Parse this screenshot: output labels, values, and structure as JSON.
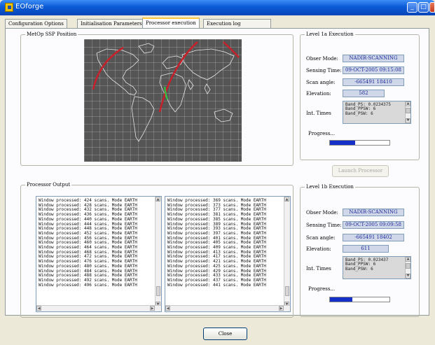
{
  "window": {
    "title": "EOforge"
  },
  "tabs": [
    "Configuration Options",
    "Initialisation Parameters",
    "Processor execution",
    "Execution log"
  ],
  "map_group": {
    "title": "MetOp SSP Position"
  },
  "level1a": {
    "title": "Level 1a Execution",
    "obser_mode_label": "Obser Mode:",
    "obser_mode": "NADIR-SCANNING",
    "sensing_time_label": "Sensing Time:",
    "sensing_time": "09-OCT-2005 09:15:08",
    "scan_angle_label": "Scan angle:",
    "scan_angle": "-665491 18410",
    "elevation_label": "Elevation:",
    "elevation": "582",
    "int_times_label": "Int. Times",
    "int_times_lines": "Band_PS: 0.0234375\nBand_PPSW: 6\nBand_PSW: 6",
    "progress_label": "Progress...",
    "progress": 0.42
  },
  "launch_button": "Launch Processor",
  "level1b": {
    "title": "Level 1b Execution",
    "obser_mode_label": "Obser Mode:",
    "obser_mode": "NADIR-SCANNING",
    "sensing_time_label": "Sensing Time:",
    "sensing_time": "09-OCT-2005 09:09:58",
    "scan_angle_label": "Scan angle:",
    "scan_angle": "-665491 18402",
    "elevation_label": "Elevation:",
    "elevation": "611",
    "int_times_label": "Int. Times",
    "int_times_lines": "Band_PS: 0.023437\nBand_PPSW: 6\nBand_PSW: 6",
    "progress_label": "Progress...",
    "progress": 0.38
  },
  "processor_output": {
    "title": "Processor Output",
    "left_lines": "Window processed: 424 scans. Mode EARTH\nWindow processed: 428 scans. Mode EARTH\nWindow processed: 432 scans. Mode EARTH\nWindow processed: 436 scans. Mode EARTH\nWindow processed: 440 scans. Mode EARTH\nWindow processed: 444 scans. Mode EARTH\nWindow processed: 448 scans. Mode EARTH\nWindow processed: 452 scans. Mode EARTH\nWindow processed: 456 scans. Mode EARTH\nWindow processed: 460 scans. Mode EARTH\nWindow processed: 464 scans. Mode EARTH\nWindow processed: 468 scans. Mode EARTH\nWindow processed: 472 scans. Mode EARTH\nWindow processed: 476 scans. Mode EARTH\nWindow processed: 480 scans. Mode EARTH\nWindow processed: 484 scans. Mode EARTH\nWindow processed: 488 scans. Mode EARTH\nWindow processed: 492 scans. Mode EARTH\nWindow processed: 496 scans. Mode EARTH",
    "right_lines": "Window processed: 369 scans. Mode EARTH\nWindow processed: 373 scans. Mode EARTH\nWindow processed: 377 scans. Mode EARTH\nWindow processed: 381 scans. Mode EARTH\nWindow processed: 385 scans. Mode EARTH\nWindow processed: 389 scans. Mode EARTH\nWindow processed: 393 scans. Mode EARTH\nWindow processed: 397 scans. Mode EARTH\nWindow processed: 401 scans. Mode EARTH\nWindow processed: 405 scans. Mode EARTH\nWindow processed: 409 scans. Mode EARTH\nWindow processed: 413 scans. Mode EARTH\nWindow processed: 417 scans. Mode EARTH\nWindow processed: 421 scans. Mode EARTH\nWindow processed: 425 scans. Mode EARTH\nWindow processed: 429 scans. Mode EARTH\nWindow processed: 433 scans. Mode EARTH\nWindow processed: 437 scans. Mode EARTH\nWindow processed: 441 scans. Mode EARTH"
  },
  "close_button": "Close",
  "colors": {
    "titlebar": "#0a5ad6",
    "progress_fill": "#1430c9",
    "value_text": "#1e2a9a",
    "orbit_track": "#c8202a",
    "map_bg": "#555555"
  },
  "icons": {
    "app": "eoforge-logo-icon",
    "minimize": "minimize-icon",
    "maximize": "maximize-icon",
    "close": "close-icon"
  }
}
